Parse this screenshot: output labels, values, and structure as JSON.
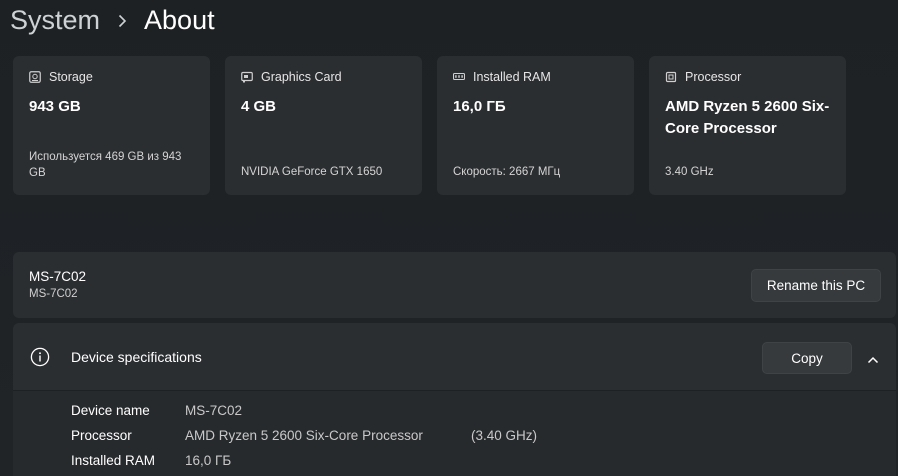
{
  "breadcrumb": {
    "parent": "System",
    "current": "About"
  },
  "cards": [
    {
      "title": "Storage",
      "icon": "storage-icon",
      "value": "943 GB",
      "detail": "Используется 469 GB из 943 GB"
    },
    {
      "title": "Graphics Card",
      "icon": "graphics-card-icon",
      "value": "4 GB",
      "detail": "NVIDIA GeForce GTX 1650"
    },
    {
      "title": "Installed RAM",
      "icon": "ram-icon",
      "value": "16,0 ГБ",
      "detail": "Скорость: 2667 МГц"
    },
    {
      "title": "Processor",
      "icon": "processor-icon",
      "value": "AMD Ryzen 5 2600 Six-Core Processor",
      "detail": "3.40 GHz"
    }
  ],
  "pc": {
    "name": "MS-7C02",
    "model": "MS-7C02",
    "rename_label": "Rename this PC"
  },
  "specs": {
    "title": "Device specifications",
    "copy_label": "Copy",
    "rows": [
      {
        "label": "Device name",
        "value": "MS-7C02",
        "extra": ""
      },
      {
        "label": "Processor",
        "value": "AMD Ryzen 5 2600 Six-Core Processor",
        "extra": "(3.40 GHz)"
      },
      {
        "label": "Installed RAM",
        "value": "16,0 ГБ",
        "extra": ""
      }
    ]
  }
}
